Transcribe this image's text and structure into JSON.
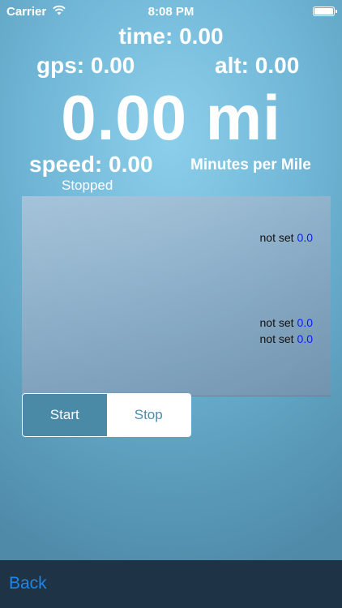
{
  "status_bar": {
    "carrier": "Carrier",
    "time": "8:08 PM"
  },
  "stats": {
    "time": "time: 0.00",
    "gps": "gps: 0.00",
    "alt": "alt: 0.00",
    "distance": "0.00 mi",
    "speed": "speed: 0.00",
    "pace_label": "Minutes per Mile",
    "state": "Stopped"
  },
  "splits": [
    {
      "label": "not set",
      "value": "0.0"
    },
    {
      "label": "not set",
      "value": "0.0"
    },
    {
      "label": "not set",
      "value": "0.0"
    }
  ],
  "controls": {
    "start_label": "Start",
    "stop_label": "Stop",
    "selected": "Stop"
  },
  "toolbar": {
    "back_label": "Back"
  },
  "colors": {
    "background": "#70b6d6",
    "toolbar": "#1f3346",
    "link_blue": "#1e86e6",
    "value_blue": "#0a1cf0"
  }
}
